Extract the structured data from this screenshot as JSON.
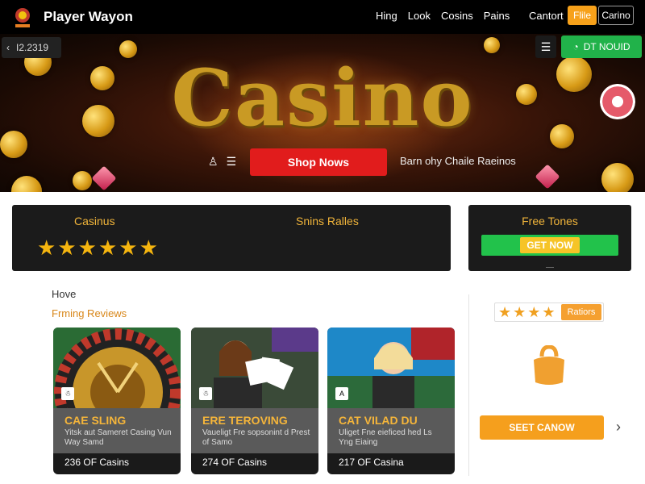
{
  "header": {
    "brand": "Player Wayon",
    "nav": [
      "Hing",
      "Look",
      "Cosins",
      "Pains"
    ],
    "contact": "Cantort",
    "file_label": "Flile",
    "casino_label": "Carino"
  },
  "hero": {
    "back_label": "I2.2319",
    "title": "Casino",
    "cta_right": "DT NOUID",
    "shop_label": "Shop Nows",
    "tagline": "Barn ohy Chaile Raeinos"
  },
  "summary": {
    "left_heading_1": "Casinus",
    "left_heading_2": "Snins Ralles",
    "stars": [
      "★",
      "★",
      "★",
      "★",
      "★",
      "★"
    ],
    "right_heading": "Free Tones",
    "get_now": "GET NOW"
  },
  "section": {
    "title": "Hove",
    "subtitle": "Frming Reviews"
  },
  "cards": [
    {
      "title": "CAE SLING",
      "desc": "Yitsk aut Sameret Casing Vun Way Samd",
      "count": "236 OF Casins",
      "tag": "☃"
    },
    {
      "title": "ERE TEROVING",
      "desc": "Vaueligt Fre sopsonint d Prest of Samo",
      "count": "274 OF Casins",
      "tag": "☃"
    },
    {
      "title": "CAT VILAD DU",
      "desc": "Uliget Fne eieficed hed Ls Yng Eiaing",
      "count": "217 OF Casina",
      "tag": "A"
    }
  ],
  "sidebar": {
    "rating_stars": [
      "★",
      "★",
      "★",
      "★"
    ],
    "rating_label": "Ratiors",
    "select_label": "SEET CANOW",
    "chevron": "›"
  },
  "colors": {
    "accent_orange": "#f59f1d",
    "accent_green": "#22c24b",
    "accent_red": "#e11c1c",
    "gold": "#c99a24"
  }
}
